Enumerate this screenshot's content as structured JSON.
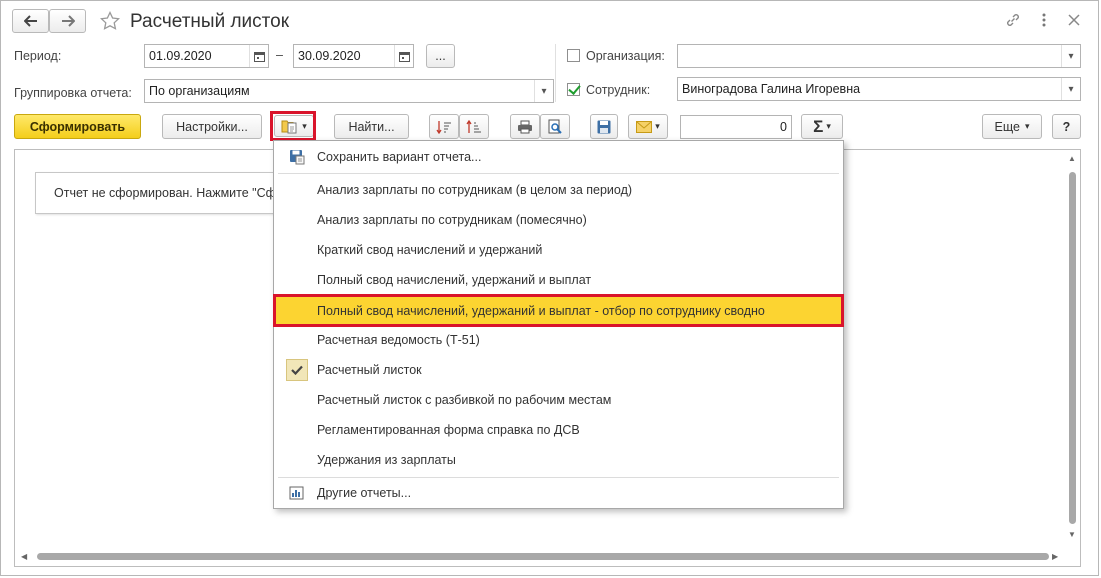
{
  "window": {
    "title": "Расчетный листок",
    "nav_back_icon": "arrow-left-icon",
    "nav_forward_icon": "arrow-right-icon",
    "favorite_icon": "star-icon",
    "link_icon": "link-icon",
    "more_icon": "kebab-icon",
    "close_icon": "close-icon"
  },
  "filters": {
    "period_label": "Период:",
    "period_from": "01.09.2020",
    "period_dash": "–",
    "period_to": "30.09.2020",
    "period_select_label": "...",
    "grouping_label": "Группировка отчета:",
    "grouping_value": "По организациям",
    "organization_label": "Организация:",
    "organization_checked": false,
    "organization_value": "",
    "employee_label": "Сотрудник:",
    "employee_checked": true,
    "employee_value": "Виноградова Галина Игоревна"
  },
  "toolbar": {
    "generate_label": "Сформировать",
    "settings_label": "Настройки...",
    "find_label": "Найти...",
    "amount_value": "0",
    "sum_symbol": "Σ",
    "more_label": "Еще",
    "help_label": "?"
  },
  "report": {
    "message": "Отчет не сформирован. Нажмите \"Сформировать\" для получения отчета."
  },
  "menu": {
    "save_variant": "Сохранить вариант отчета...",
    "items": [
      "Анализ зарплаты по сотрудникам (в целом за период)",
      "Анализ зарплаты по сотрудникам (помесячно)",
      "Краткий свод начислений и удержаний",
      "Полный свод начислений, удержаний и выплат",
      "Полный свод начислений, удержаний и выплат - отбор по сотруднику сводно",
      "Расчетная ведомость (Т-51)",
      "Расчетный листок",
      "Расчетный листок с разбивкой по рабочим местам",
      "Регламентированная форма справка по ДСВ",
      "Удержания из зарплаты"
    ],
    "other_reports": "Другие отчеты..."
  },
  "colors": {
    "primary_button": "#f4ce1b",
    "highlight": "#fcd431",
    "red_frame": "#d9142b"
  }
}
